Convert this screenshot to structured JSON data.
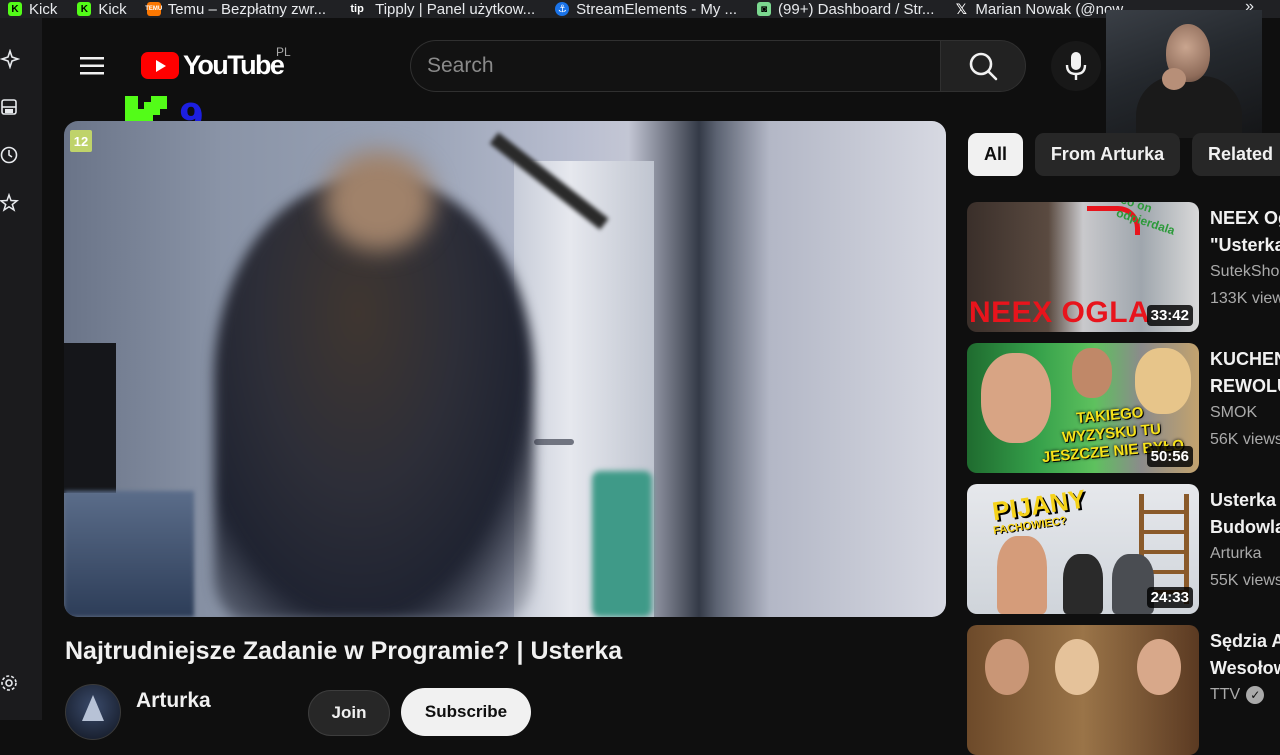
{
  "bookmarks": [
    {
      "label": "Kick",
      "icon": "kick-icon",
      "color": "#53fc18"
    },
    {
      "label": "Kick",
      "icon": "kick-icon",
      "color": "#53fc18"
    },
    {
      "label": "Temu – Bezpłatny zwr...",
      "icon": "temu-icon",
      "color": "#fb7701"
    },
    {
      "label": "Tipply | Panel użytkow...",
      "icon": "tipply-icon",
      "color": "#202124"
    },
    {
      "label": "StreamElements - My ...",
      "icon": "streamelements-icon",
      "color": "#1a73e8"
    },
    {
      "label": "(99+) Dashboard / Str...",
      "icon": "twitch-icon",
      "color": "#7bd88f"
    },
    {
      "label": "Marian Nowak (@now...",
      "icon": "x-icon",
      "color": "#202124"
    }
  ],
  "header": {
    "logo_text": "YouTube",
    "region": "PL",
    "search_placeholder": "Search"
  },
  "overlay": {
    "k9_number": "9"
  },
  "player": {
    "age_rating": "12"
  },
  "video": {
    "title": "Najtrudniejsze Zadanie w Programie? | Usterka",
    "channel": "Arturka",
    "join_label": "Join",
    "subscribe_label": "Subscribe"
  },
  "chips": [
    {
      "label": "All",
      "selected": true
    },
    {
      "label": "From Arturka",
      "selected": false
    },
    {
      "label": "Related",
      "selected": false
    }
  ],
  "recommendations": [
    {
      "title_lines": [
        "NEEX Og",
        "\"Usterka"
      ],
      "channel": "SutekSho",
      "views": "133K view",
      "duration": "33:42",
      "thumb_text": "NEEX OGLA",
      "thumb_caption": "co on odpierdala"
    },
    {
      "title_lines": [
        "KUCHEN",
        "REWOLU"
      ],
      "channel": "SMOK",
      "views": "56K views",
      "duration": "50:56",
      "thumb_text": "TAKIEGO WYZYSKU TU JESZCZE NIE BYŁO"
    },
    {
      "title_lines": [
        "Usterka",
        "Budowla"
      ],
      "channel": "Arturka",
      "views": "55K views",
      "duration": "24:33",
      "thumb_text": "PIJANY",
      "thumb_sub": "FACHOWIEC?"
    },
    {
      "title_lines": [
        "Sędzia A",
        "Wesołow"
      ],
      "channel": "TTV",
      "verified": true
    }
  ]
}
